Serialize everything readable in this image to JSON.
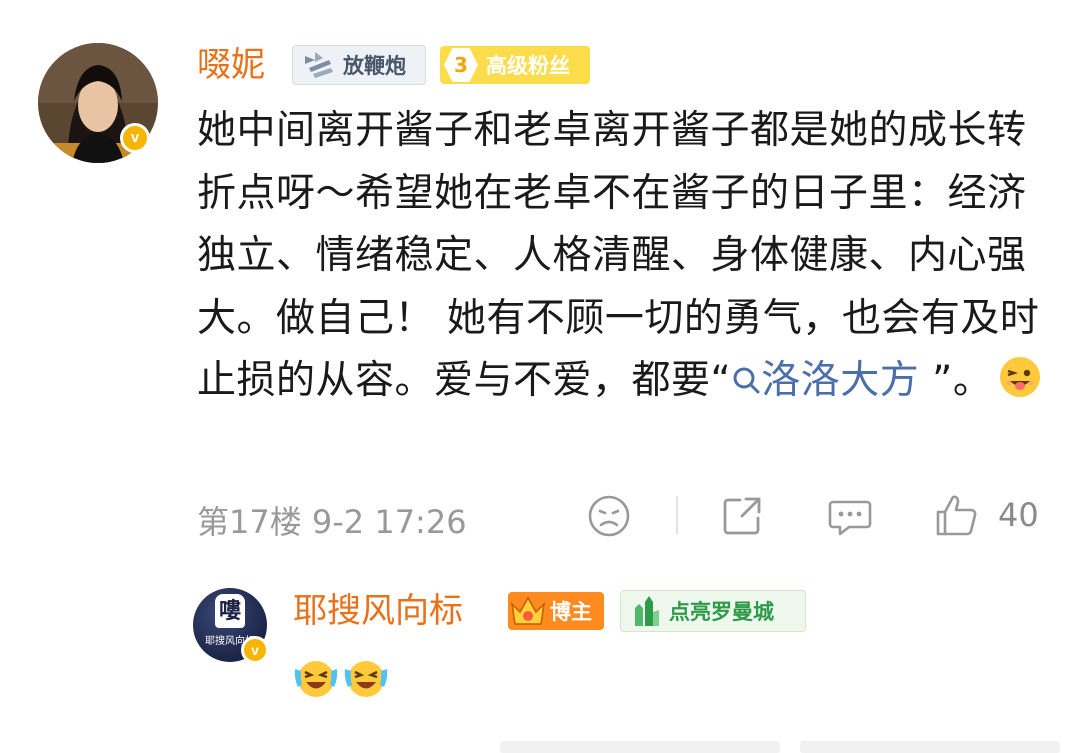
{
  "comment": {
    "username": "啜妮",
    "verified_badge": "v",
    "badges": {
      "firecracker": "放鞭炮",
      "fan_level": "3",
      "fan_label": "高级粉丝"
    },
    "text_before": "她中间离开酱子和老卓离开酱子都是她的成长转折点呀～希望她在老卓不在酱子的日子里：经济独立、情绪稳定、人格清醒、身体健康、内心强大。做自己！ 她有不顾一切的勇气，也会有及时止损的从容。爱与不爱，都要“",
    "topic": "洛洛大方",
    "text_after": " ”。",
    "floor_time": "第17楼  9-2 17:26",
    "like_count": "40"
  },
  "reply": {
    "username": "耶搜风向标",
    "avatar_text": "嘍",
    "avatar_subtext": "耶搜风向标",
    "verified_badge": "v",
    "badges": {
      "blogger": "博主",
      "city": "点亮罗曼城"
    }
  },
  "icons": {
    "dislike": "sad-face-icon",
    "share": "share-icon",
    "comment": "comment-bubble-icon",
    "like": "thumbs-up-icon",
    "topic": "search-icon",
    "emoji": "grin-tongue-emoji",
    "reply_emoji": "laughing-tears-emoji"
  },
  "colors": {
    "username": "#e8711a",
    "link": "#4b6fa8",
    "meta": "#999999",
    "fan_badge": "#fbdc4a",
    "blogger_badge": "#ff8a1f",
    "verified": "#f7b500"
  }
}
